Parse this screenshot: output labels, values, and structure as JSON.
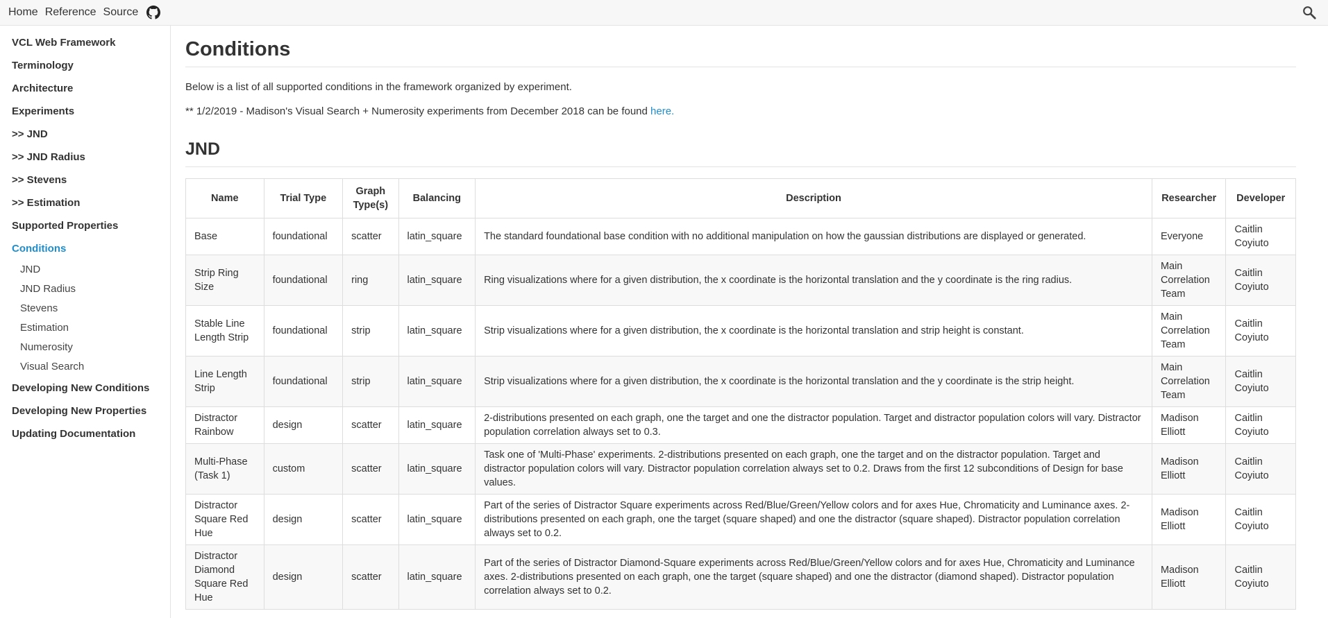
{
  "topbar": {
    "links": [
      "Home",
      "Reference",
      "Source"
    ],
    "icons": [
      "github-icon",
      "search-icon"
    ]
  },
  "sidebar": {
    "items": [
      {
        "label": "VCL Web Framework"
      },
      {
        "label": "Terminology"
      },
      {
        "label": "Architecture"
      },
      {
        "label": "Experiments"
      },
      {
        "label": ">> JND"
      },
      {
        "label": ">> JND Radius"
      },
      {
        "label": ">> Stevens"
      },
      {
        "label": ">> Estimation"
      },
      {
        "label": "Supported Properties"
      },
      {
        "label": "Conditions"
      }
    ],
    "active": "Conditions",
    "sub_items": [
      "JND",
      "JND Radius",
      "Stevens",
      "Estimation",
      "Numerosity",
      "Visual Search"
    ],
    "after_items": [
      {
        "label": "Developing New Conditions"
      },
      {
        "label": "Developing New Properties"
      },
      {
        "label": "Updating Documentation"
      }
    ]
  },
  "main": {
    "title": "Conditions",
    "intro": "Below is a list of all supported conditions in the framework organized by experiment.",
    "note_text": "** 1/2/2019 - Madison's Visual Search + Numerosity experiments from December 2018 can be found ",
    "note_link": "here.",
    "section_title": "JND",
    "table": {
      "headers": [
        "Name",
        "Trial Type",
        "Graph Type(s)",
        "Balancing",
        "Description",
        "Researcher",
        "Developer"
      ],
      "rows": [
        [
          "Base",
          "foundational",
          "scatter",
          "latin_square",
          "The standard foundational base condition with no additional manipulation on how the gaussian distributions are displayed or generated.",
          "Everyone",
          "Caitlin Coyiuto"
        ],
        [
          "Strip Ring Size",
          "foundational",
          "ring",
          "latin_square",
          "Ring visualizations where for a given distribution, the x coordinate is the horizontal translation and the y coordinate is the ring radius.",
          "Main Correlation Team",
          "Caitlin Coyiuto"
        ],
        [
          "Stable Line Length Strip",
          "foundational",
          "strip",
          "latin_square",
          "Strip visualizations where for a given distribution, the x coordinate is the horizontal translation and strip height is constant.",
          "Main Correlation Team",
          "Caitlin Coyiuto"
        ],
        [
          "Line Length Strip",
          "foundational",
          "strip",
          "latin_square",
          "Strip visualizations where for a given distribution, the x coordinate is the horizontal translation and the y coordinate is the strip height.",
          "Main Correlation Team",
          "Caitlin Coyiuto"
        ],
        [
          "Distractor Rainbow",
          "design",
          "scatter",
          "latin_square",
          "2-distributions presented on each graph, one the target and one the distractor population. Target and distractor population colors will vary. Distractor population correlation always set to 0.3.",
          "Madison Elliott",
          "Caitlin Coyiuto"
        ],
        [
          "Multi-Phase (Task 1)",
          "custom",
          "scatter",
          "latin_square",
          "Task one of 'Multi-Phase' experiments. 2-distributions presented on each graph, one the target and on the distractor population. Target and distractor population colors will vary. Distractor population correlation always set to 0.2. Draws from the first 12 subconditions of Design for base values.",
          "Madison Elliott",
          "Caitlin Coyiuto"
        ],
        [
          "Distractor Square Red Hue",
          "design",
          "scatter",
          "latin_square",
          "Part of the series of Distractor Square experiments across Red/Blue/Green/Yellow colors and for axes Hue, Chromaticity and Luminance axes. 2-distributions presented on each graph, one the target (square shaped) and one the distractor (square shaped). Distractor population correlation always set to 0.2.",
          "Madison Elliott",
          "Caitlin Coyiuto"
        ],
        [
          "Distractor Diamond Square Red Hue",
          "design",
          "scatter",
          "latin_square",
          "Part of the series of Distractor Diamond-Square experiments across Red/Blue/Green/Yellow colors and for axes Hue, Chromaticity and Luminance axes. 2-distributions presented on each graph, one the target (square shaped) and one the distractor (diamond shaped). Distractor population correlation always set to 0.2.",
          "Madison Elliott",
          "Caitlin Coyiuto"
        ]
      ]
    }
  }
}
